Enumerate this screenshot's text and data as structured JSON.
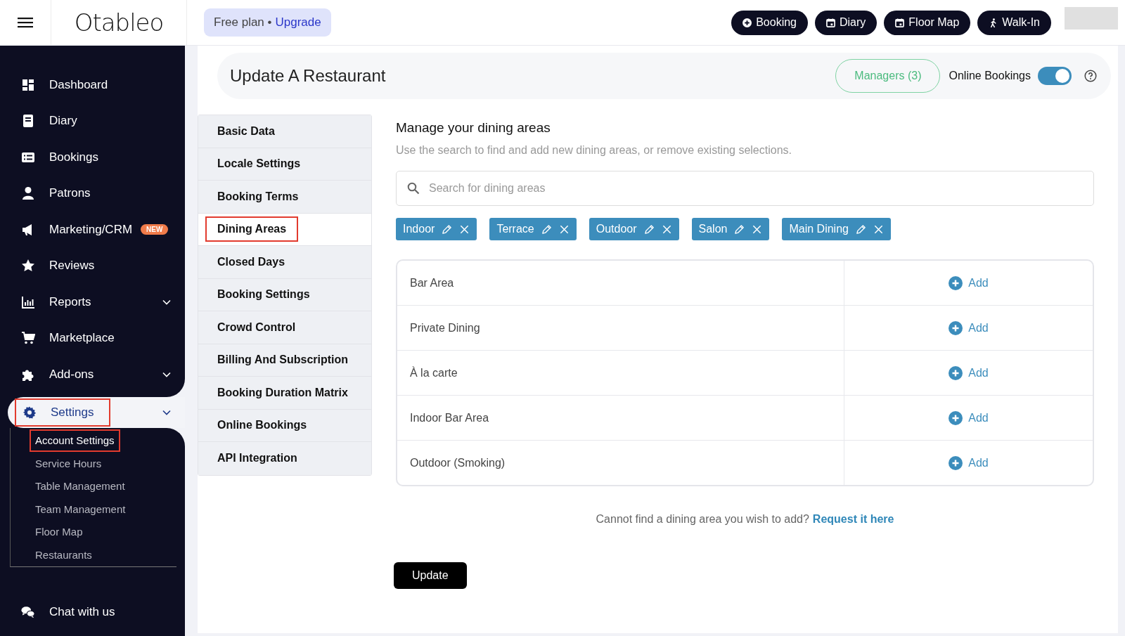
{
  "header": {
    "logo": "Otableo",
    "plan": {
      "text": "Free plan",
      "separator": "•",
      "link": "Upgrade"
    },
    "actions": [
      {
        "label": "Booking"
      },
      {
        "label": "Diary"
      },
      {
        "label": "Floor Map"
      },
      {
        "label": "Walk-In"
      }
    ]
  },
  "sidebar": {
    "items": [
      {
        "label": "Dashboard",
        "expandable": false,
        "selected": false,
        "highlighted": false
      },
      {
        "label": "Diary",
        "expandable": false,
        "selected": false,
        "highlighted": false
      },
      {
        "label": "Bookings",
        "expandable": false,
        "selected": false,
        "highlighted": false
      },
      {
        "label": "Patrons",
        "expandable": false,
        "selected": false,
        "highlighted": false
      },
      {
        "label": "Marketing/CRM",
        "badge": "NEW",
        "expandable": false,
        "selected": false,
        "highlighted": false
      },
      {
        "label": "Reviews",
        "expandable": false,
        "selected": false,
        "highlighted": false
      },
      {
        "label": "Reports",
        "expandable": true,
        "selected": false,
        "highlighted": false
      },
      {
        "label": "Marketplace",
        "expandable": false,
        "selected": false,
        "highlighted": false
      },
      {
        "label": "Add-ons",
        "expandable": true,
        "selected": false,
        "highlighted": false
      },
      {
        "label": "Settings",
        "expandable": true,
        "selected": true,
        "highlighted": true,
        "children": [
          {
            "label": "Account Settings",
            "selected": true,
            "highlighted": true
          },
          {
            "label": "Service Hours",
            "selected": false,
            "highlighted": false
          },
          {
            "label": "Table Management",
            "selected": false,
            "highlighted": false
          },
          {
            "label": "Team Management",
            "selected": false,
            "highlighted": false
          },
          {
            "label": "Floor Map",
            "selected": false,
            "highlighted": false
          },
          {
            "label": "Restaurants",
            "selected": false,
            "highlighted": false
          }
        ]
      }
    ],
    "chat": "Chat with us"
  },
  "page": {
    "title": "Update A Restaurant",
    "managers": "Managers (3)",
    "online_bookings": {
      "label": "Online Bookings",
      "on": true
    }
  },
  "tabs": [
    {
      "label": "Basic Data",
      "selected": false,
      "highlighted": false
    },
    {
      "label": "Locale Settings",
      "selected": false,
      "highlighted": false
    },
    {
      "label": "Booking Terms",
      "selected": false,
      "highlighted": false
    },
    {
      "label": "Dining Areas",
      "selected": true,
      "highlighted": true
    },
    {
      "label": "Closed Days",
      "selected": false,
      "highlighted": false
    },
    {
      "label": "Booking Settings",
      "selected": false,
      "highlighted": false
    },
    {
      "label": "Crowd Control",
      "selected": false,
      "highlighted": false
    },
    {
      "label": "Billing And Subscription",
      "selected": false,
      "highlighted": false
    },
    {
      "label": "Booking Duration Matrix",
      "selected": false,
      "highlighted": false
    },
    {
      "label": "Online Bookings",
      "selected": false,
      "highlighted": false
    },
    {
      "label": "API Integration",
      "selected": false,
      "highlighted": false
    }
  ],
  "dining": {
    "heading": "Manage your dining areas",
    "description": "Use the search to find and add new dining areas, or remove existing selections.",
    "search": {
      "placeholder": "Search for dining areas"
    },
    "selected_areas": [
      "Indoor",
      "Terrace",
      "Outdoor",
      "Salon",
      "Main Dining"
    ],
    "available_areas": [
      {
        "name": "Bar Area",
        "action": "Add"
      },
      {
        "name": "Private Dining",
        "action": "Add"
      },
      {
        "name": "À la carte",
        "action": "Add"
      },
      {
        "name": "Indoor Bar Area",
        "action": "Add"
      },
      {
        "name": "Outdoor (Smoking)",
        "action": "Add"
      }
    ],
    "note": {
      "text": "Cannot find a dining area you wish to add?",
      "link": "Request it here"
    }
  },
  "submit": "Update"
}
